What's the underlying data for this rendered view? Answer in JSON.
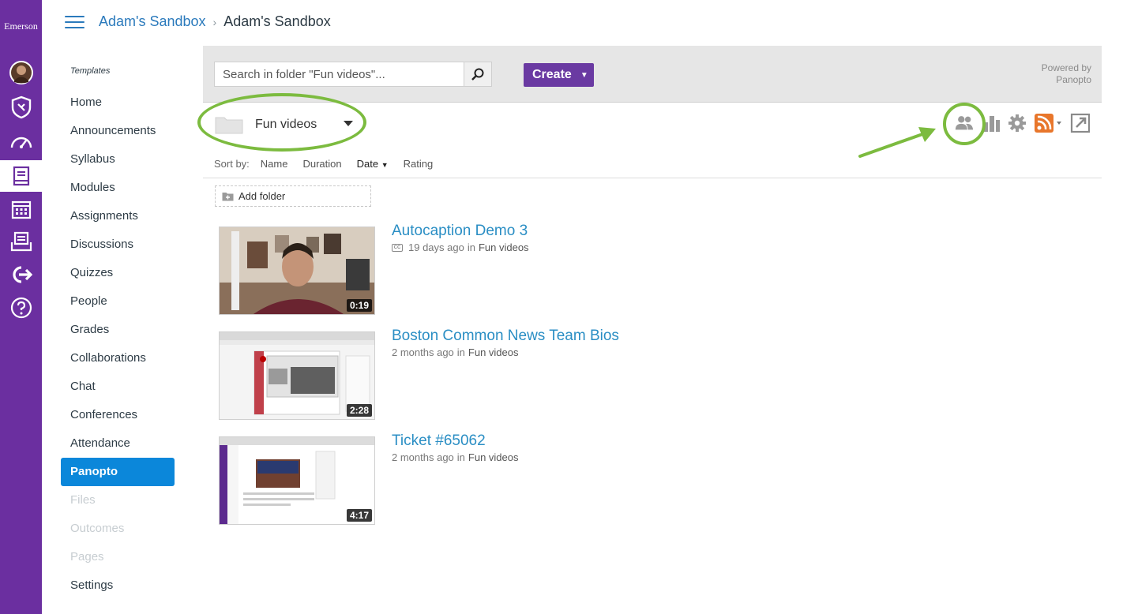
{
  "global_nav": {
    "brand": "Emerson",
    "items": [
      "account",
      "admin",
      "dashboard",
      "courses",
      "calendar",
      "inbox",
      "commons",
      "help"
    ]
  },
  "header": {
    "breadcrumb": [
      "Adam's Sandbox",
      "Adam's Sandbox"
    ],
    "separator": "›"
  },
  "course_nav": {
    "section_title": "Templates",
    "items": [
      {
        "label": "Home",
        "state": "normal"
      },
      {
        "label": "Announcements",
        "state": "normal"
      },
      {
        "label": "Syllabus",
        "state": "normal"
      },
      {
        "label": "Modules",
        "state": "normal"
      },
      {
        "label": "Assignments",
        "state": "normal"
      },
      {
        "label": "Discussions",
        "state": "normal"
      },
      {
        "label": "Quizzes",
        "state": "normal"
      },
      {
        "label": "People",
        "state": "normal"
      },
      {
        "label": "Grades",
        "state": "normal"
      },
      {
        "label": "Collaborations",
        "state": "normal"
      },
      {
        "label": "Chat",
        "state": "normal"
      },
      {
        "label": "Conferences",
        "state": "normal"
      },
      {
        "label": "Attendance",
        "state": "normal"
      },
      {
        "label": "Panopto",
        "state": "active"
      },
      {
        "label": "Files",
        "state": "disabled"
      },
      {
        "label": "Outcomes",
        "state": "disabled"
      },
      {
        "label": "Pages",
        "state": "disabled"
      },
      {
        "label": "Settings",
        "state": "normal"
      }
    ]
  },
  "panopto": {
    "search_placeholder": "Search in folder \"Fun videos\"...",
    "create_label": "Create",
    "create_caret": "▼",
    "powered_by": [
      "Powered by",
      "Panopto"
    ],
    "folder_name": "Fun videos",
    "sort": {
      "label": "Sort by:",
      "options": [
        "Name",
        "Duration",
        "Date",
        "Rating"
      ],
      "active": "Date",
      "active_caret": "▼"
    },
    "add_folder_label": "Add folder",
    "sessions": [
      {
        "title": "Autocaption Demo 3",
        "age": "19 days ago",
        "in_label": "in",
        "folder": "Fun videos",
        "duration": "0:19",
        "has_captions": true,
        "caption_badge": "CC"
      },
      {
        "title": "Boston Common News Team Bios",
        "age": "2 months ago",
        "in_label": "in",
        "folder": "Fun videos",
        "duration": "2:28",
        "has_captions": false
      },
      {
        "title": "Ticket #65062",
        "age": "2 months ago",
        "in_label": "in",
        "folder": "Fun videos",
        "duration": "4:17",
        "has_captions": false
      }
    ]
  },
  "colors": {
    "global_nav": "#6b2fa0",
    "link": "#2b7abc",
    "active_nav": "#0b87da",
    "create_button": "#6a3aa2",
    "annotation": "#7cbb3f",
    "rss": "#e8762b"
  }
}
